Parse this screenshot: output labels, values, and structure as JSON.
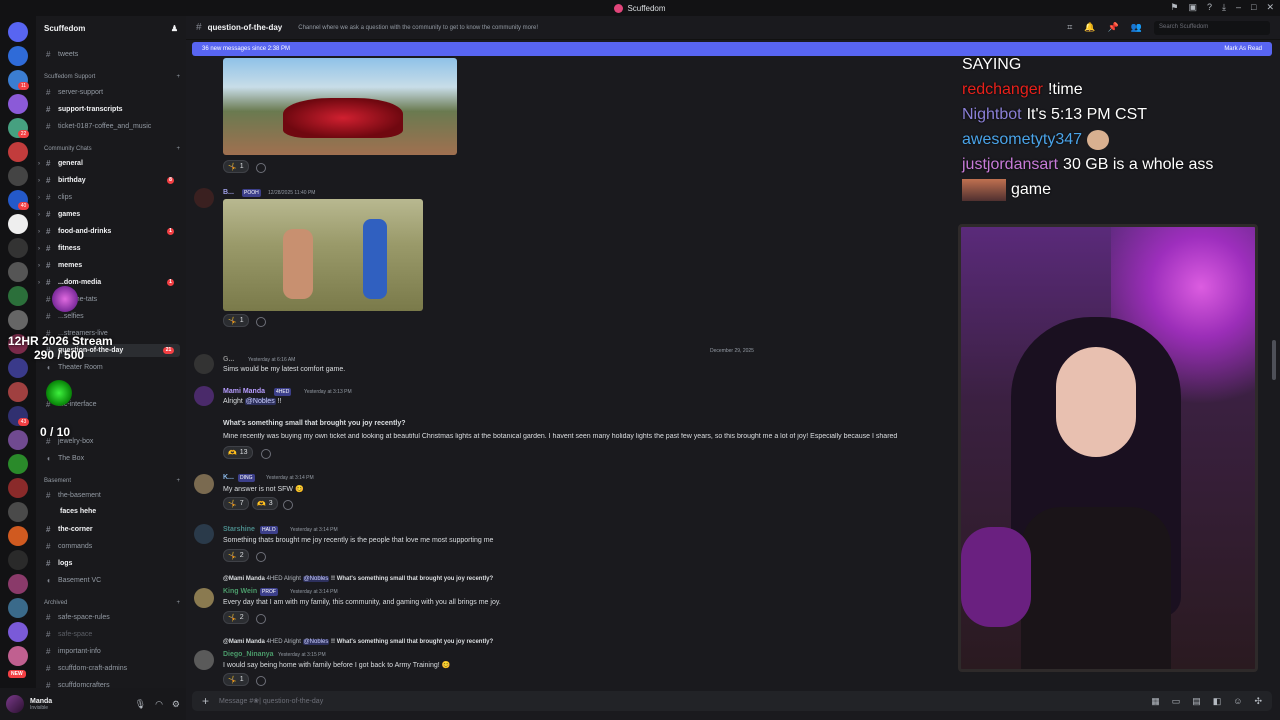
{
  "window": {
    "title": "Scuffedom"
  },
  "server": {
    "name": "Scuffedom"
  },
  "sidebar": {
    "top_channel": "tweets",
    "cat_support": "Scuffedom Support",
    "support": [
      "server-support",
      "support-transcripts",
      "ticket-0187-coffee_and_music"
    ],
    "cat_community": "Community Chats",
    "community": [
      "general",
      "birthday",
      "clips",
      "games",
      "food-and-drinks",
      "fitness",
      "memes",
      "...dom-media",
      "...off-the-tats",
      "...selfies",
      "...streamers-live",
      "question-of-the-day",
      "Theater Room",
      "...c-interface",
      "jewelry-box",
      "The Box"
    ],
    "cat_basement": "Basement",
    "basement": [
      "the-basement",
      "faces hehe",
      "the-corner",
      "commands",
      "logs",
      "Basement VC"
    ],
    "cat_archived": "Archived",
    "archived": [
      "safe-space-rules",
      "safe-space",
      "important-info",
      "scuffdom-craft-admins",
      "scuffdomcrafters"
    ],
    "badges": {
      "birthday": "8",
      "food": "1",
      "media": "1",
      "qotd": "21"
    }
  },
  "overlay": {
    "stream_title": "12HR 2026 Stream",
    "stream_count": "290 / 500",
    "count2": "0 / 10",
    "new": "NEW"
  },
  "user": {
    "name": "Manda",
    "status": "Invisible"
  },
  "channel": {
    "name": "question-of-the-day",
    "topic": "Channel where we ask a question with the community to get to know the community more!",
    "search_placeholder": "Search Scuffedom",
    "new_messages": "36 new messages since 2:38 PM",
    "mark_read": "Mark As Read"
  },
  "messages": {
    "r1": "1",
    "m2": {
      "user": "B...",
      "badge": "POOH",
      "ts": "12/28/2025 11:40 PM",
      "react": "1"
    },
    "date": "December 29, 2025",
    "m3": {
      "user": "G...",
      "ts": "Yesterday at 6:16 AM",
      "text": "Sims would be my latest comfort game."
    },
    "m4": {
      "user": "Mami Manda",
      "badge": "4HED",
      "ts": "Yesterday at 3:13 PM",
      "text": "Alright",
      "mention": "@Nobles",
      "text2": "!!",
      "question": "What's something small that brought you joy recently?",
      "body": "Mine recently was buying my own ticket and looking at beautiful Christmas lights at the botanical garden. I havent seen many holiday lights the past few years, so this brought me a lot of joy! Especially because I shared",
      "react": "13"
    },
    "m5": {
      "user": "K...",
      "badge": "DING",
      "ts": "Yesterday at 3:14 PM",
      "text": "My answer is not SFW",
      "r1": "7",
      "r2": "3"
    },
    "m6": {
      "user": "Starshine",
      "badge": "HALO",
      "ts": "Yesterday at 3:14 PM",
      "text": "Something thats brought me joy recently is the people that love me most supporting me",
      "react": "2"
    },
    "m7": {
      "reply_user": "@Mami Manda",
      "reply_badge": "4HED",
      "reply_text": "Alright",
      "reply_mention": "@Nobles",
      "reply_q": "!! What's something small that brought you joy recently?",
      "user": "King Wein",
      "badge": "PROF",
      "ts": "Yesterday at 3:14 PM",
      "text": "Every day that I am with my family, this community, and gaming with you all brings me joy.",
      "react": "2"
    },
    "m8": {
      "reply_user": "@Mami Manda",
      "reply_badge": "4HED",
      "reply_text": "Alright",
      "reply_mention": "@Nobles",
      "reply_q": "!! What's something small that brought you joy recently?",
      "user": "Diego_Ninanya",
      "ts": "Yesterday at 3:15 PM",
      "text": "I would say being home with family before I got back to Army Training!",
      "react": "1"
    }
  },
  "composer": {
    "placeholder": "Message #❀| question-of-the-day"
  },
  "twitch_chat": [
    {
      "user": "",
      "text": "SAYING",
      "color": "#ffffff"
    },
    {
      "user": "redchanger",
      "text": "!time",
      "color": "#e8211b"
    },
    {
      "user": "Nightbot",
      "text": "It's 5:13 PM CST",
      "color": "#8a7fd6"
    },
    {
      "user": "awesometyty347",
      "text": "",
      "color": "#4aa3e8"
    },
    {
      "user": "justjordansart",
      "text": "30 GB is a whole ass",
      "color": "#c77bd8"
    },
    {
      "user": "",
      "text": "game",
      "color": "#ffffff"
    }
  ]
}
